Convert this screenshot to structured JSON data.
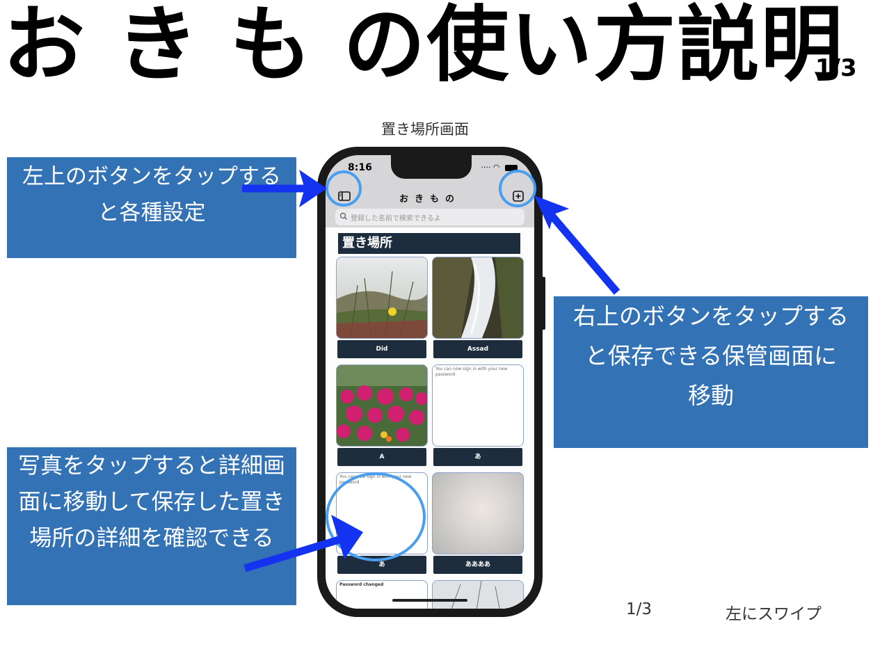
{
  "header": {
    "title": "おきもの使い方説明",
    "title_chars": [
      "お",
      "き",
      "も",
      "の使い方説明"
    ],
    "page_indicator": "1/3"
  },
  "screen_caption": "置き場所画面",
  "callouts": {
    "top_left": [
      "左上のボタンをタップする",
      "と各種設定"
    ],
    "top_right": [
      "右上のボタンをタップする",
      "と保存できる保管画面に",
      "移動"
    ],
    "bottom_left": [
      "写真をタップすると詳細画",
      "面に移動して保存した置き",
      "場所の詳細を確認できる"
    ]
  },
  "footer": {
    "page": "1/3",
    "swipe_hint": "左にスワイプ"
  },
  "phone": {
    "status_time": "8:16",
    "nav_title": "おきもの",
    "search_placeholder": "登録した名前で検索できるよ",
    "section_title": "置き場所",
    "cards": [
      {
        "label": "Did",
        "image": "grass-flower-photo"
      },
      {
        "label": "Assad",
        "image": "waterfall-photo"
      },
      {
        "label": "A",
        "image": "pink-flowers-photo"
      },
      {
        "label": "あ",
        "image": "text-note",
        "note": "You can now sign in with your new password"
      },
      {
        "label": "あ",
        "image": "text-note",
        "note": "You can now sign in with your new password"
      },
      {
        "label": "ああああ",
        "image": "blurred-photo"
      },
      {
        "label": "",
        "image": "text-note",
        "note": "Password changed"
      },
      {
        "label": "",
        "image": "grass-photo"
      }
    ]
  },
  "colors": {
    "callout_bg": "#3372b5",
    "arrow": "#1433f0",
    "highlight_circle": "#4a9ef0",
    "card_label_bg": "#1d2d3d"
  }
}
